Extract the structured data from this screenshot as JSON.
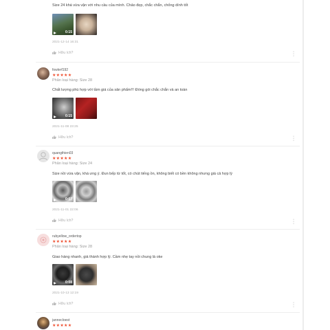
{
  "reviews": [
    {
      "text": "Size 24 khá vừa vặn với nhu cầu của mình. Chảo đẹp, chắc chắn, chống dính tốt",
      "video_duration": "0:15",
      "date": "2021-12-14 16:31",
      "like_label": "Hữu ích?"
    },
    {
      "username": "fowlerf192",
      "stars": "★★★★★",
      "variant": "Phân loại hàng: Size 28",
      "text": "Chất lượng phù hợp với tầm giá của sản phẩm!!! Đóng gói chắc chắn và an toàn",
      "video_duration": "0:15",
      "date": "2021-11-08 23:25",
      "like_label": "Hữu ích?"
    },
    {
      "username": "quangthien03",
      "stars": "★★★★★",
      "variant": "Phân loại hàng: Size 24",
      "text": "Size nồi vừa vặn, khá ưng ý. Đun bếp từ tốt, có chút tiếng ồn, không biết có bền không nhưng giá cả hợp lý",
      "video_duration": "0:07",
      "date": "2021-11-01 22:06",
      "like_label": "Hữu ích?"
    },
    {
      "username": "rubyellow_ordertop",
      "stars": "★★★★★",
      "variant": "Phân loại hàng: Size 28",
      "text": "Giao hàng nhanh, giá thành hợp lý. Cầm nhẹ tay nồi chung là oke",
      "video_duration": "0:08",
      "date": "2021-10-13 12:19",
      "like_label": "Hữu ích?"
    },
    {
      "username": "jannecloest",
      "stars": "★★★★★"
    }
  ],
  "colors": {
    "star": "#ee4d2d",
    "divider": "#ededed"
  }
}
